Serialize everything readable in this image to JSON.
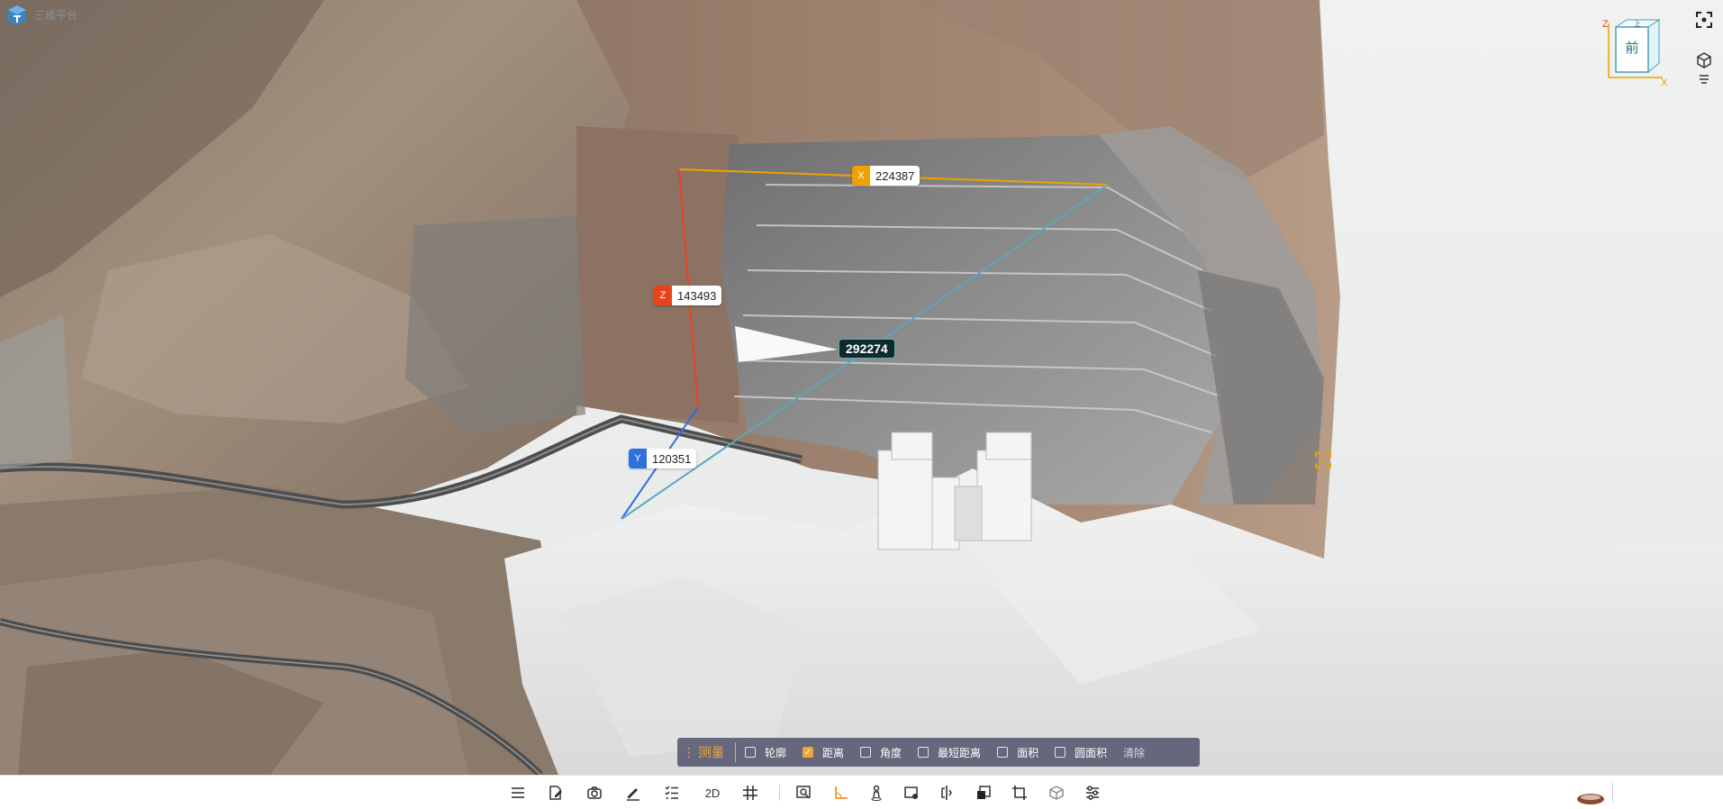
{
  "app": {
    "title": "三维平台"
  },
  "view_cube": {
    "top_face": "上",
    "front_face": "前",
    "axis_z": "Z",
    "axis_x": "X"
  },
  "right_tools": [
    {
      "icon": "fullscreen-icon"
    },
    {
      "icon": "layers-icon"
    },
    {
      "icon": "menu-icon"
    }
  ],
  "measurements": {
    "x": {
      "axis": "X",
      "value": "224387",
      "color": "#f0a000"
    },
    "y": {
      "axis": "Y",
      "value": "120351",
      "color": "#2f6fe0"
    },
    "z": {
      "axis": "Z",
      "value": "143493",
      "color": "#e8441c"
    },
    "total": {
      "value": "292274",
      "color": "#58a8c0"
    }
  },
  "measure_panel": {
    "title": "测量",
    "options": [
      {
        "label": "轮廓",
        "checked": false
      },
      {
        "label": "距离",
        "checked": true
      },
      {
        "label": "角度",
        "checked": false
      },
      {
        "label": "最短距离",
        "checked": false
      },
      {
        "label": "面积",
        "checked": false
      },
      {
        "label": "圆面积",
        "checked": false
      }
    ],
    "clear_label": "清除"
  },
  "toolbar": {
    "items": [
      {
        "icon": "list-icon"
      },
      {
        "icon": "edit-doc-icon"
      },
      {
        "icon": "camera-icon"
      },
      {
        "icon": "pen-icon"
      },
      {
        "icon": "checklist-icon"
      },
      {
        "icon": "2d-icon",
        "label": "2D"
      },
      {
        "icon": "grid-icon"
      },
      {
        "icon": "zoom-region-icon"
      },
      {
        "icon": "measure-angle-icon"
      },
      {
        "icon": "person-icon"
      },
      {
        "icon": "annotate-icon"
      },
      {
        "icon": "split-view-icon"
      },
      {
        "icon": "section-box-icon"
      },
      {
        "icon": "crop-icon"
      },
      {
        "icon": "cube-icon"
      },
      {
        "icon": "settings-sliders-icon"
      }
    ]
  },
  "colors": {
    "accent": "#f0a53a",
    "panel_bg": "#54586e"
  }
}
